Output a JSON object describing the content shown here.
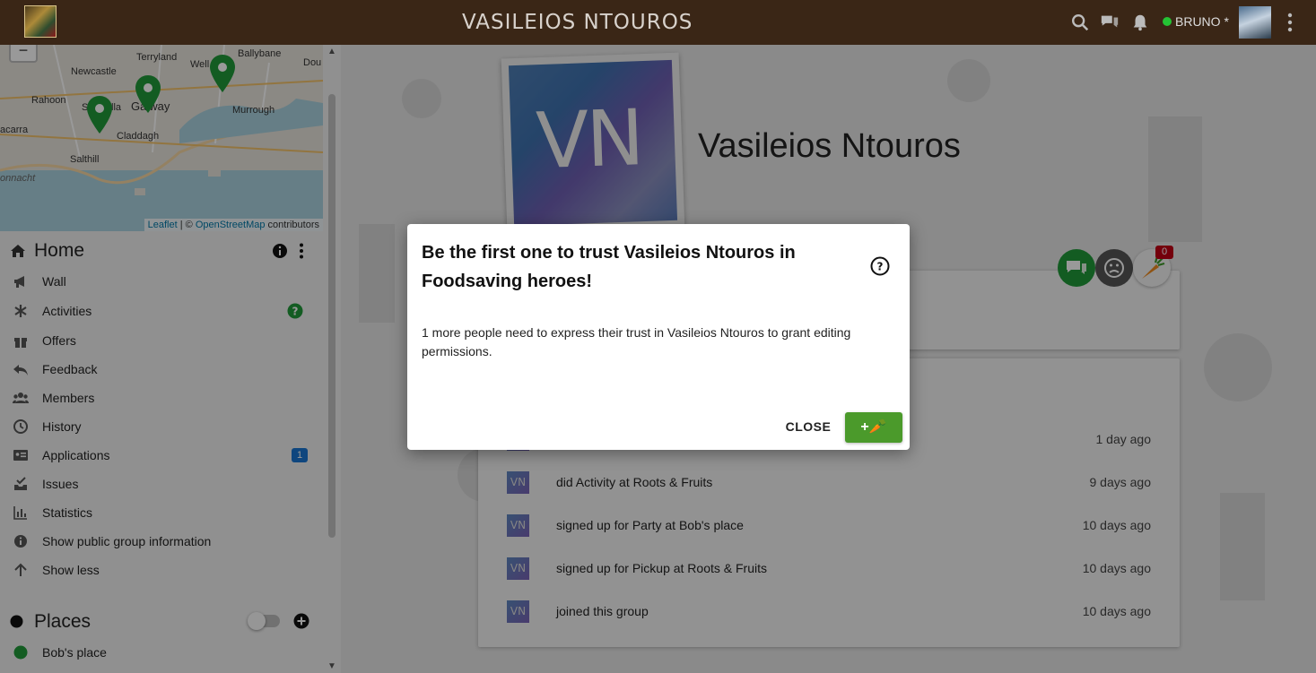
{
  "topbar": {
    "title": "VASILEIOS NTOUROS",
    "user_name": "BRUNO *"
  },
  "map": {
    "zoom_out_label": "−",
    "labels": [
      "Terryland",
      "Ballybane",
      "Newcastle",
      "Well",
      "Dou",
      "Rahoon",
      "S",
      "lla",
      "Galway",
      "Murrough",
      "acarra",
      "Claddagh",
      "Salthill",
      "onnacht"
    ],
    "attribution_leaflet": "Leaflet",
    "attribution_sep": " | © ",
    "attribution_osm": "OpenStreetMap",
    "attribution_tail": " contributors"
  },
  "sidebar": {
    "home_label": "Home",
    "items": [
      {
        "label": "Wall"
      },
      {
        "label": "Activities"
      },
      {
        "label": "Offers"
      },
      {
        "label": "Feedback"
      },
      {
        "label": "Members"
      },
      {
        "label": "History"
      },
      {
        "label": "Applications",
        "badge": "1"
      },
      {
        "label": "Issues"
      },
      {
        "label": "Statistics"
      },
      {
        "label": "Show public group information"
      },
      {
        "label": "Show less"
      }
    ],
    "places_label": "Places",
    "places": [
      {
        "label": "Bob's place",
        "color": "#21ba45"
      }
    ]
  },
  "profile": {
    "initials": "VN",
    "name": "Vasileios Ntouros",
    "trust_count": "0"
  },
  "history": [
    {
      "avatar": "VN",
      "text": "",
      "time": "1 day ago"
    },
    {
      "avatar": "VN",
      "text": "did Activity at Roots & Fruits",
      "time": "9 days ago"
    },
    {
      "avatar": "VN",
      "text": "signed up for Party at Bob's place",
      "time": "10 days ago"
    },
    {
      "avatar": "VN",
      "text": "signed up for Pickup at Roots & Fruits",
      "time": "10 days ago"
    },
    {
      "avatar": "VN",
      "text": "joined this group",
      "time": "10 days ago"
    }
  ],
  "dialog": {
    "title": "Be the first one to trust Vasileios Ntouros in Foodsaving heroes!",
    "body": "1 more people need to express their trust in Vasileios Ntouros to grant editing permissions.",
    "close_label": "CLOSE",
    "trust_label": "+🥕"
  },
  "colors": {
    "topbar": "#3a2616",
    "accent_green": "#4b9a2b",
    "badge_blue": "#1976d2",
    "badge_red": "#c10015"
  }
}
